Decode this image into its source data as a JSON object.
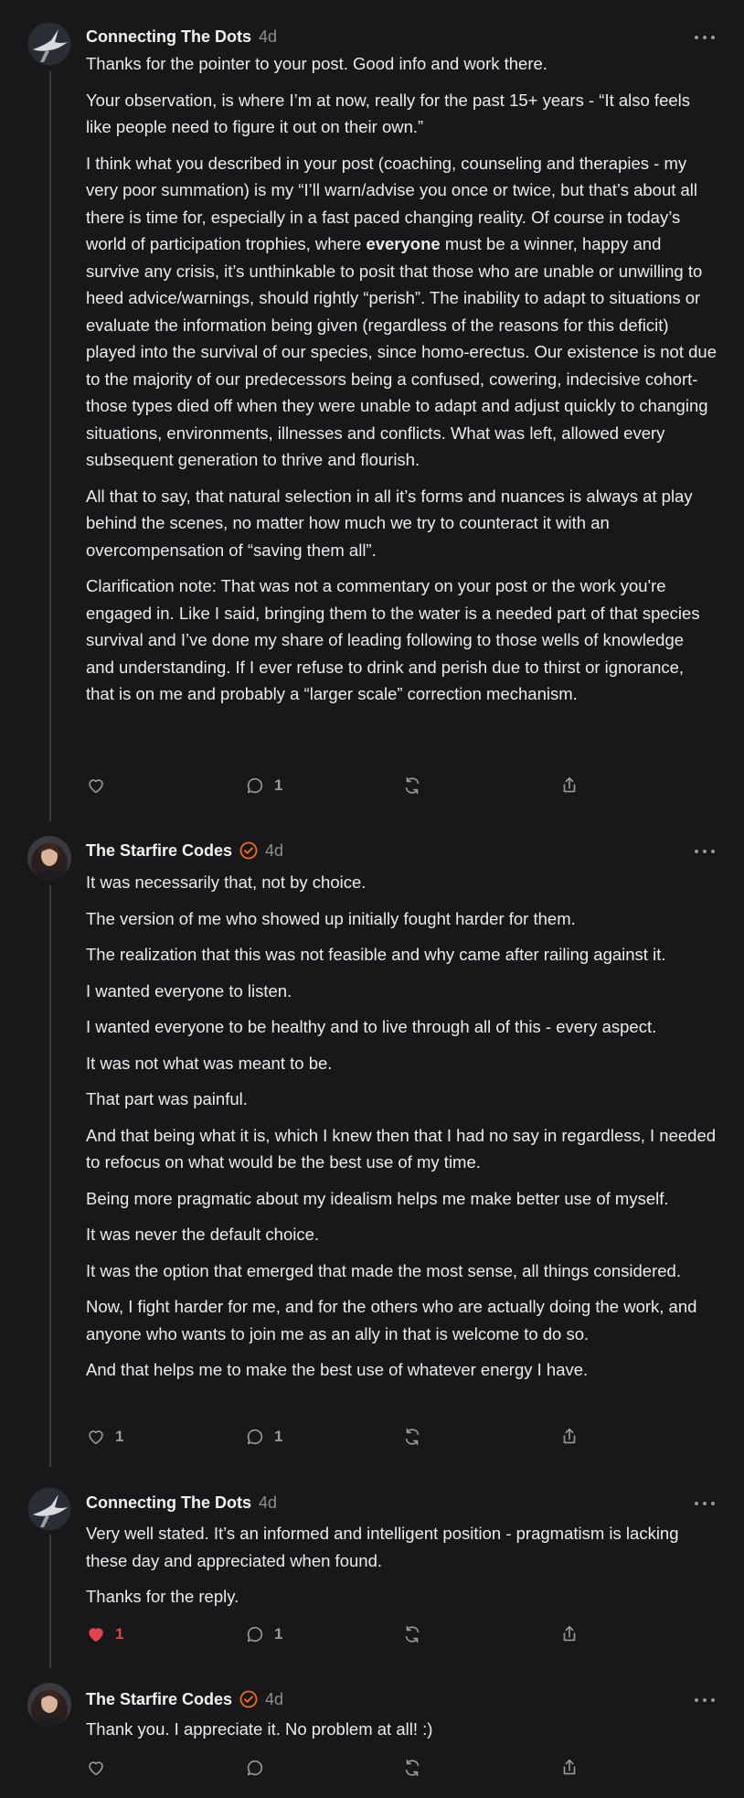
{
  "colors": {
    "background": "#18181a",
    "text": "#ececec",
    "muted": "#8e8e93",
    "like_active": "#e0434e",
    "verified": "#f26b1d"
  },
  "comments": [
    {
      "author": "Connecting The Dots",
      "time": "4d",
      "verified": false,
      "avatar_icon": "bird-silhouette-avatar",
      "paragraphs": [
        "Thanks for the pointer to your post. Good info and work there.",
        "Your observation, is where I’m at now, really for the past 15+ years - “It also feels like people need to figure it out on their own.”",
        "I think what you described in your post (coaching, counseling and therapies - my very poor summation) is my “I’ll warn/advise you once or twice, but that’s about all there is time for, especially in a fast paced changing reality. Of course in today’s world of participation trophies, where ",
        "everyone",
        " must be a winner, happy and survive any crisis, it’s unthinkable to posit that those who are unable or unwilling to heed advice/warnings, should rightly “perish”. The inability to adapt to situations or evaluate the information being given (regardless of the reasons for this deficit) played into the survival of our species, since homo-erectus. Our existence is not due to the majority of our predecessors being a confused, cowering, indecisive cohort- those types died off when they were unable to adapt and adjust quickly to changing situations, environments, illnesses and conflicts. What was left, allowed every subsequent generation to thrive and flourish.",
        "All that to say, that natural selection in all it’s forms and nuances is always at play behind the scenes, no matter how much we try to counteract it with an overcompensation of “saving them all”.",
        "Clarification note: That was not a commentary on your post or the work you're engaged in. Like I said, bringing them to the water is a needed part of that species survival and I’ve done my share of leading following to those wells of knowledge and understanding. If I ever refuse to drink and perish due to thirst or ignorance, that is on me and probably a “larger scale” correction mechanism."
      ],
      "likes": "",
      "replies": "1"
    },
    {
      "author": "The Starfire Codes",
      "time": "4d",
      "verified": true,
      "avatar_icon": "woman-portrait-avatar",
      "paragraphs": [
        "It was necessarily that, not by choice.",
        "The version of me who showed up initially fought harder for them.",
        "The realization that this was not feasible and why came after railing against it.",
        "I wanted everyone to listen.",
        "I wanted everyone to be healthy and to live through all of this - every aspect.",
        "It was not what was meant to be.",
        "That part was painful.",
        "And that being what it is, which I knew then that I had no say in regardless, I needed to refocus on what would be the best use of my time.",
        "Being more pragmatic about my idealism helps me make better use of myself.",
        "It was never the default choice.",
        "It was the option that emerged that made the most sense, all things considered.",
        "Now, I fight harder for me, and for the others who are actually doing the work, and anyone who wants to join me as an ally in that is welcome to do so.",
        "And that helps me to make the best use of whatever energy I have."
      ],
      "likes": "1",
      "replies": "1"
    },
    {
      "author": "Connecting The Dots",
      "time": "4d",
      "verified": false,
      "avatar_icon": "bird-silhouette-avatar",
      "paragraphs": [
        "Very well stated. It’s an informed and intelligent position - pragmatism is lacking these day and appreciated when found.",
        "Thanks for the reply."
      ],
      "likes": "1",
      "liked": true,
      "replies": "1"
    },
    {
      "author": "The Starfire Codes",
      "time": "4d",
      "verified": true,
      "avatar_icon": "woman-portrait-avatar",
      "paragraphs": [
        "Thank you. I appreciate it. No problem at all! :)"
      ],
      "likes": "",
      "replies": ""
    }
  ]
}
